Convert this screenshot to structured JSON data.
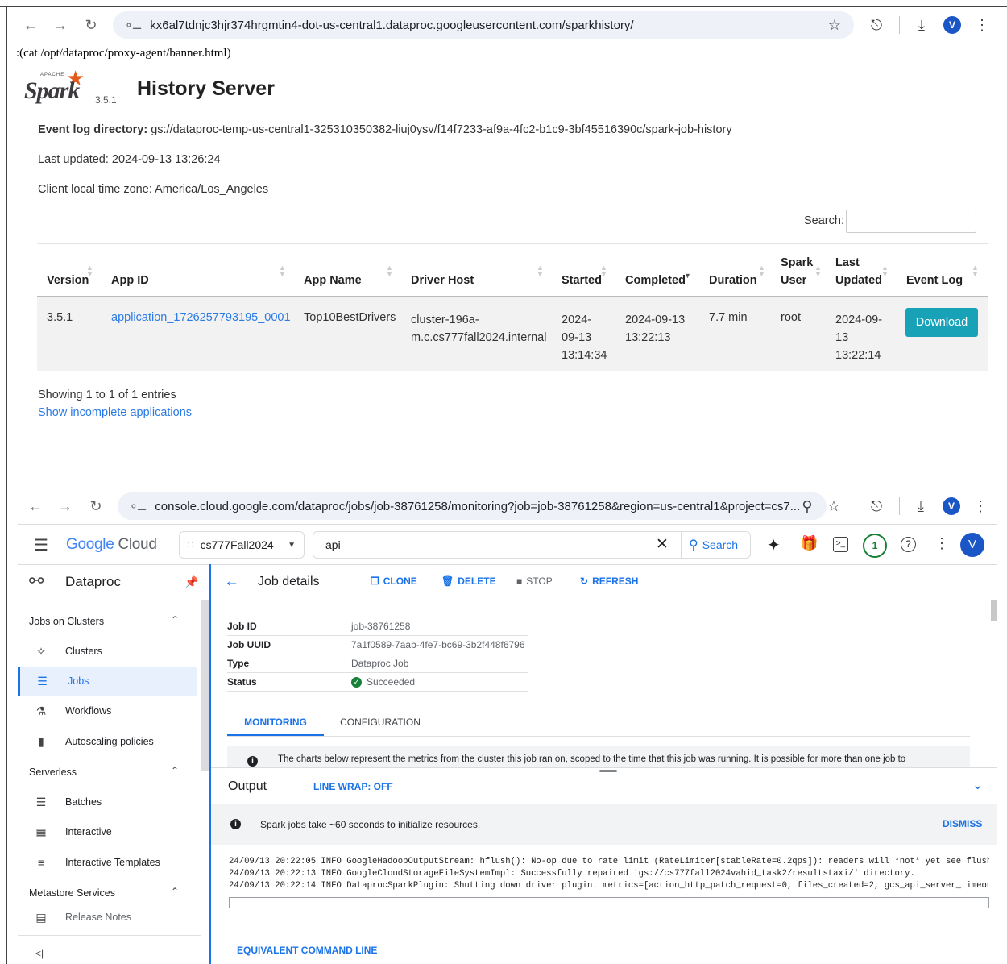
{
  "browser1": {
    "url": "kx6al7tdnjc3hjr374hrgmtin4-dot-us-central1.dataproc.googleusercontent.com/sparkhistory/",
    "avatar": "V"
  },
  "spark": {
    "banner": ":(cat /opt/dataproc/proxy-agent/banner.html)",
    "logo_small": "APACHE",
    "logo_text": "Spark",
    "version": "3.5.1",
    "title": "History Server",
    "event_log_label": "Event log directory:",
    "event_log_value": "gs://dataproc-temp-us-central1-325310350382-liuj0ysv/f14f7233-af9a-4fc2-b1c9-3bf45516390c/spark-job-history",
    "last_updated": "Last updated: 2024-09-13 13:26:24",
    "timezone": "Client local time zone: America/Los_Angeles",
    "search_label": "Search:",
    "search_value": "",
    "columns": [
      "Version",
      "App ID",
      "App Name",
      "Driver Host",
      "Started",
      "Completed",
      "Duration",
      "Spark User",
      "Last Updated",
      "Event Log"
    ],
    "column_lines": {
      "spark_user": [
        "Spark",
        "User"
      ],
      "last_updated": [
        "Last",
        "Updated"
      ]
    },
    "row": {
      "version": "3.5.1",
      "app_id": "application_1726257793195_0001",
      "app_name": "Top10BestDrivers",
      "driver_host_l1": "cluster-196a-",
      "driver_host_l2": "m.c.cs777fall2024.internal",
      "started_l1": "2024-",
      "started_l2": "09-13",
      "started_l3": "13:14:34",
      "completed_l1": "2024-09-13",
      "completed_l2": "13:22:13",
      "duration": "7.7 min",
      "user": "root",
      "updated_l1": "2024-09-",
      "updated_l2": "13",
      "updated_l3": "13:22:14",
      "download": "Download"
    },
    "showing": "Showing 1 to 1 of 1 entries",
    "incomplete_link": "Show incomplete applications"
  },
  "browser2": {
    "url": "console.cloud.google.com/dataproc/jobs/job-38761258/monitoring?job=job-38761258&region=us-central1&project=cs7...",
    "avatar": "V"
  },
  "console": {
    "logo_google": "Google",
    "logo_cloud": "Cloud",
    "project": "cs777Fall2024",
    "search_value": "api",
    "search_button": "Search",
    "notif_count": "1",
    "user_avatar": "V",
    "product": "Dataproc",
    "sidebar": {
      "section1": "Jobs on Clusters",
      "items1": [
        "Clusters",
        "Jobs",
        "Workflows",
        "Autoscaling policies"
      ],
      "section2": "Serverless",
      "items2": [
        "Batches",
        "Interactive",
        "Interactive Templates"
      ],
      "section3": "Metastore Services",
      "release_notes": "Release Notes",
      "collapse": "<|"
    },
    "page_title": "Job details",
    "actions": {
      "clone": "CLONE",
      "delete": "DELETE",
      "stop": "STOP",
      "refresh": "REFRESH"
    },
    "details": [
      {
        "key": "Job ID",
        "value": "job-38761258"
      },
      {
        "key": "Job UUID",
        "value": "7a1f0589-7aab-4fe7-bc69-3b2f448f6796"
      },
      {
        "key": "Type",
        "value": "Dataproc Job"
      },
      {
        "key": "Status",
        "value": "Succeeded"
      }
    ],
    "tabs": {
      "monitoring": "MONITORING",
      "configuration": "CONFIGURATION"
    },
    "info_text": "The charts below represent the metrics from the cluster this job ran on, scoped to the time that this job was running. It is possible for more than one job to",
    "output_title": "Output",
    "line_wrap": "LINE WRAP: OFF",
    "notice": "Spark jobs take ~60 seconds to initialize resources.",
    "dismiss": "DISMISS",
    "log_lines": [
      "24/09/13 20:22:05 INFO GoogleHadoopOutputStream: hflush(): No-op due to rate limit (RateLimiter[stableRate=0.2qps]): readers will *not* yet see flushed d",
      "24/09/13 20:22:13 INFO GoogleCloudStorageFileSystemImpl: Successfully repaired 'gs://cs777fall2024vahid_task2/resultstaxi/' directory.",
      "24/09/13 20:22:14 INFO DataprocSparkPlugin: Shutting down driver plugin. metrics=[action_http_patch_request=0, files_created=2, gcs_api_server_timeout_cc"
    ],
    "equivalent": "EQUIVALENT COMMAND LINE"
  }
}
